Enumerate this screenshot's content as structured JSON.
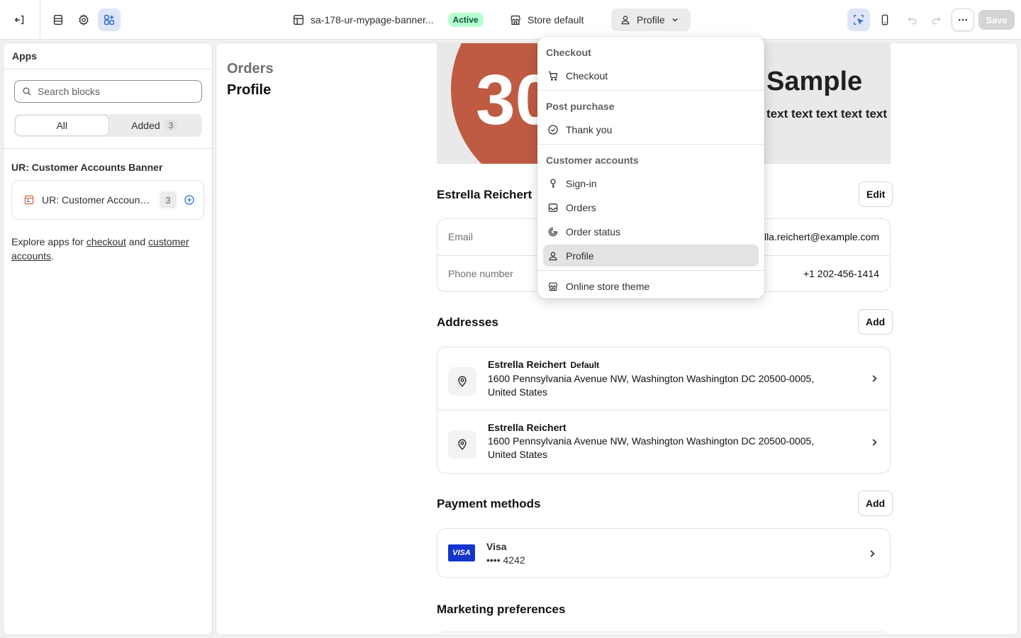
{
  "topbar": {
    "template_name": "sa-178-ur-mypage-banner...",
    "status": "Active",
    "store": "Store default",
    "page_selector": "Profile",
    "save_label": "Save"
  },
  "sidebar": {
    "title": "Apps",
    "search_placeholder": "Search blocks",
    "tabs": [
      {
        "label": "All"
      },
      {
        "label": "Added",
        "count": "3"
      }
    ],
    "section_title": "UR: Customer Accounts Banner",
    "app": {
      "name": "UR: Customer Accounts Banner",
      "count": "3"
    },
    "explore": {
      "prefix": "Explore apps for ",
      "link1": "checkout",
      "middle": " and ",
      "link2": "customer accounts",
      "suffix": "."
    }
  },
  "canvas": {
    "nav": {
      "orders": "Orders",
      "profile": "Profile"
    },
    "banner": {
      "number": "30",
      "title": "Sample",
      "subtitle": "text text text text text"
    },
    "profile": {
      "name": "Estrella Reichert",
      "edit_label": "Edit",
      "rows": [
        {
          "label": "Email",
          "value": "estrella.reichert@example.com"
        },
        {
          "label": "Phone number",
          "value": "+1 202-456-1414"
        }
      ]
    },
    "addresses": {
      "title": "Addresses",
      "add_label": "Add",
      "items": [
        {
          "name": "Estrella Reichert",
          "tag": "Default",
          "line1": "1600 Pennsylvania Avenue NW, Washington Washington DC 20500-0005,",
          "line2": "United States"
        },
        {
          "name": "Estrella Reichert",
          "tag": "",
          "line1": "1600 Pennsylvania Avenue NW, Washington Washington DC 20500-0005,",
          "line2": "United States"
        }
      ]
    },
    "payment": {
      "title": "Payment methods",
      "add_label": "Add",
      "card_brand_badge": "VISA",
      "card_name": "Visa",
      "card_number": "•••• 4242"
    },
    "marketing": {
      "title": "Marketing preferences"
    }
  },
  "dropdown": {
    "groups": [
      {
        "title": "Checkout",
        "items": [
          {
            "label": "Checkout",
            "icon": "cart-icon"
          }
        ]
      },
      {
        "title": "Post purchase",
        "items": [
          {
            "label": "Thank you",
            "icon": "check-circle-icon"
          }
        ]
      },
      {
        "title": "Customer accounts",
        "items": [
          {
            "label": "Sign-in",
            "icon": "key-icon"
          },
          {
            "label": "Orders",
            "icon": "inbox-icon"
          },
          {
            "label": "Order status",
            "icon": "order-status-icon"
          },
          {
            "label": "Profile",
            "icon": "person-icon",
            "selected": true
          }
        ]
      }
    ],
    "footer_item": {
      "label": "Online store theme",
      "icon": "store-icon"
    }
  }
}
